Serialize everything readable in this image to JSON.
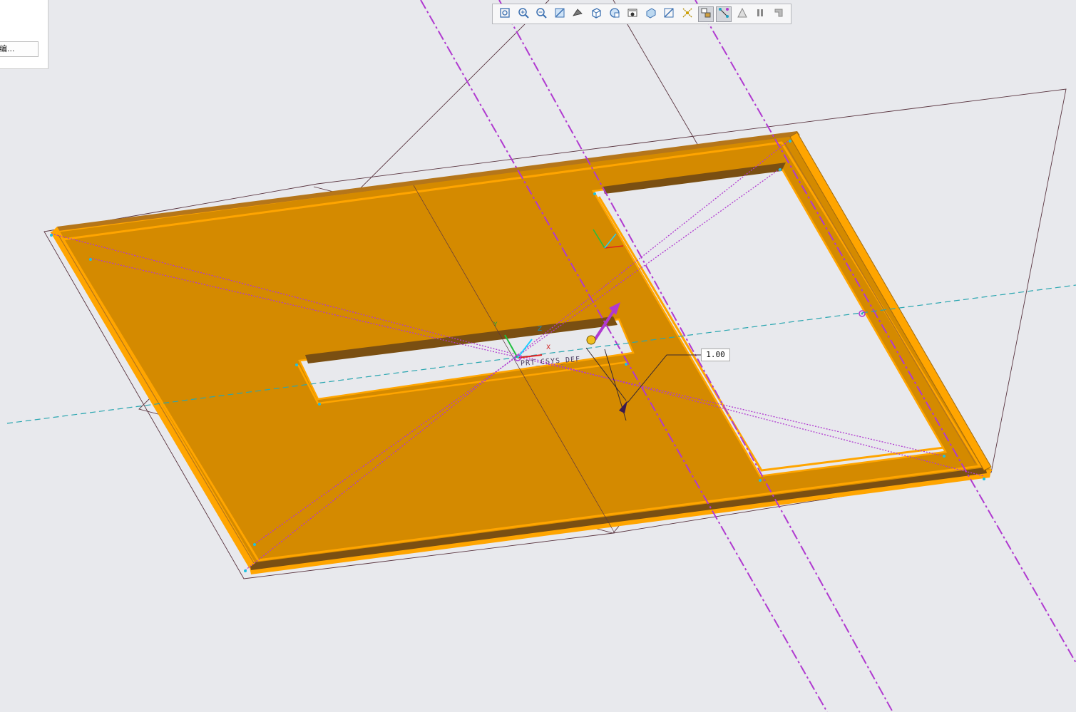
{
  "dialog": {
    "button_label": "编..."
  },
  "toolbar": {
    "items": [
      {
        "name": "refit-icon",
        "active": false
      },
      {
        "name": "zoom-in-icon",
        "active": false
      },
      {
        "name": "zoom-out-icon",
        "active": false
      },
      {
        "name": "repaint-icon",
        "active": false
      },
      {
        "name": "display-style-icon",
        "active": false
      },
      {
        "name": "saved-orientations-icon",
        "active": false
      },
      {
        "name": "view-manager-icon",
        "active": false
      },
      {
        "name": "perspective-icon",
        "active": false
      },
      {
        "name": "section-icon",
        "active": false
      },
      {
        "name": "datum-display-filters-icon",
        "active": false
      },
      {
        "name": "spin-center-icon",
        "active": false
      },
      {
        "name": "annotation-display-icon",
        "active": true
      },
      {
        "name": "sketcher-display-icon",
        "active": true
      },
      {
        "name": "appearance-icon",
        "active": false
      },
      {
        "name": "pause-icon",
        "active": false
      },
      {
        "name": "end-icon",
        "active": false
      }
    ]
  },
  "model": {
    "dimension_value": "1.00",
    "csys_label": "PRT_CSYS_DEF",
    "axis_x": "X",
    "axis_y": "Y",
    "axis_z": "Z"
  },
  "colors": {
    "background": "#e8e9ed",
    "part_face": "#d48a00",
    "part_edge": "#ffa500",
    "part_shadow": "#8a5a10",
    "datum_axis": "#b03ad0",
    "datum_plane": "#5a3540",
    "center_line": "#2aa6b0"
  }
}
